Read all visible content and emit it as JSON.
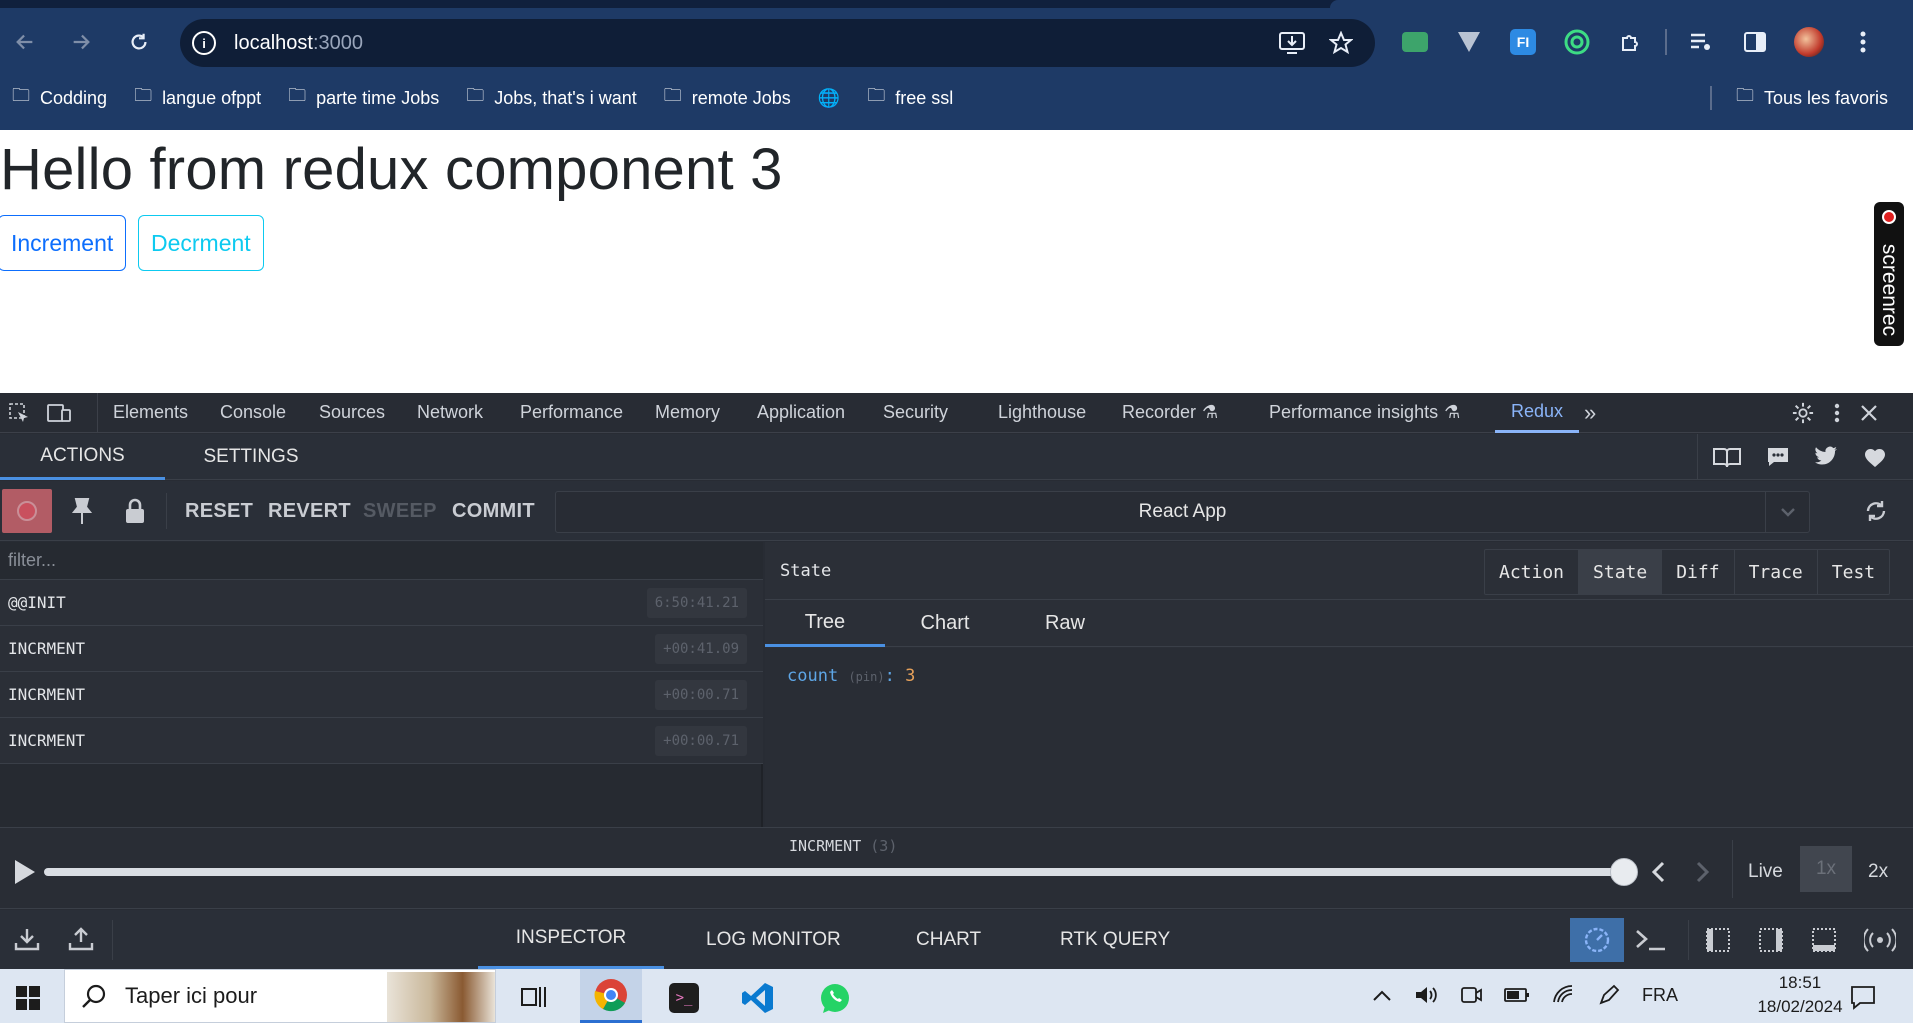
{
  "browser": {
    "url_host": "localhost",
    "url_port": ":3000",
    "bookmarks": [
      "Codding",
      "langue ofppt",
      "parte time Jobs",
      "Jobs, that's i want",
      "remote Jobs",
      "free ssl"
    ],
    "all_bookmarks": "Tous les favoris"
  },
  "page": {
    "title": "Hello from redux component 3",
    "increment_label": "Increment",
    "decrement_label": "Decrment",
    "screenrec_label": "screenrec"
  },
  "devtools": {
    "tabs": [
      "Elements",
      "Console",
      "Sources",
      "Network",
      "Performance",
      "Memory",
      "Application",
      "Security",
      "Lighthouse",
      "Recorder",
      "Performance insights",
      "Redux"
    ],
    "active_tab": "Redux",
    "redux": {
      "subtabs": [
        "ACTIONS",
        "SETTINGS"
      ],
      "toolbar": {
        "reset": "RESET",
        "revert": "REVERT",
        "sweep": "SWEEP",
        "commit": "COMMIT"
      },
      "instance": "React App",
      "filter_placeholder": "filter...",
      "actions": [
        {
          "name": "@@INIT",
          "time": "6:50:41.21"
        },
        {
          "name": "INCRMENT",
          "time": "+00:41.09"
        },
        {
          "name": "INCRMENT",
          "time": "+00:00.71"
        },
        {
          "name": "INCRMENT",
          "time": "+00:00.71"
        }
      ],
      "panel_title": "State",
      "view_buttons": [
        "Action",
        "State",
        "Diff",
        "Trace",
        "Test"
      ],
      "active_view": "State",
      "state_tabs": [
        "Tree",
        "Chart",
        "Raw"
      ],
      "active_state_tab": "Tree",
      "state": {
        "key": "count",
        "pin": "(pin)",
        "value": "3"
      },
      "slider": {
        "action_label": "INCRMENT",
        "action_index": "(3)",
        "position": 1.0,
        "live": "Live",
        "speed_1x": "1x",
        "speed_2x": "2x"
      },
      "monitors": [
        "INSPECTOR",
        "LOG MONITOR",
        "CHART",
        "RTK QUERY"
      ],
      "active_monitor": "INSPECTOR"
    }
  },
  "taskbar": {
    "search_placeholder": "Taper ici pour",
    "language": "FRA",
    "time": "18:51",
    "date": "18/02/2024"
  },
  "colors": {
    "chrome_bg": "#1e3a66",
    "devtools_bg": "#282c34",
    "accent_blue": "#4a90e2",
    "state_key": "#5ea6e6",
    "state_value": "#e5a05a"
  }
}
